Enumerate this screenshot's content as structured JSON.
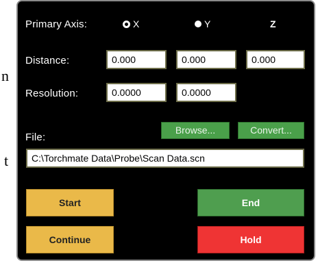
{
  "background_fragments": [
    "n",
    "t"
  ],
  "axis": {
    "label": "Primary Axis:",
    "options": [
      {
        "label": "X",
        "selected": true
      },
      {
        "label": "Y",
        "selected": false
      },
      {
        "label": "Z",
        "selected": false
      }
    ]
  },
  "distance": {
    "label": "Distance:",
    "values": [
      "0.000",
      "0.000",
      "0.000"
    ]
  },
  "resolution": {
    "label": "Resolution:",
    "values": [
      "0.0000",
      "0.0000"
    ]
  },
  "file": {
    "label": "File:",
    "browse_label": "Browse...",
    "convert_label": "Convert...",
    "path": "C:\\Torchmate Data\\Probe\\Scan Data.scn"
  },
  "buttons": {
    "start": "Start",
    "end": "End",
    "continue": "Continue",
    "hold": "Hold"
  },
  "colors": {
    "panel": "#000000",
    "start_continue": "#eab949",
    "end": "#4f9e4f",
    "hold": "#ef3434",
    "small_buttons": "#4aa04a"
  }
}
